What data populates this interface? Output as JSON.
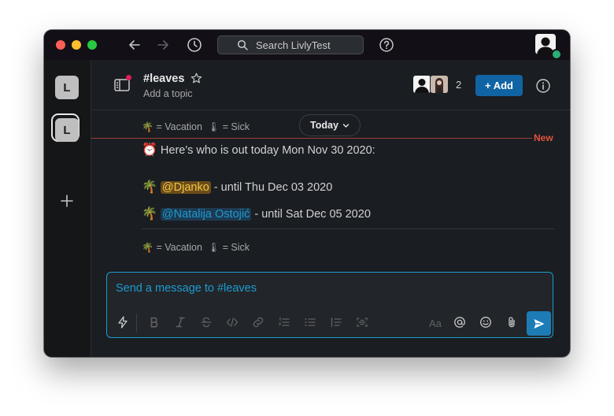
{
  "titlebar": {
    "search_placeholder": "Search LivlyTest",
    "icons": [
      "back-arrow-icon",
      "forward-arrow-icon",
      "history-clock-icon",
      "search-icon",
      "help-icon"
    ]
  },
  "workspaces": {
    "items": [
      {
        "initial": "L",
        "selected": false
      },
      {
        "initial": "L",
        "selected": true
      }
    ]
  },
  "channel": {
    "name": "#leaves",
    "topic": "Add a topic",
    "member_count": "2",
    "add_label": "+ Add"
  },
  "messages": {
    "legend_top": {
      "vacation_emoji": "🌴",
      "vacation_text": "= Vacation",
      "sick_emoji": "🌡",
      "sick_text": "= Sick"
    },
    "date_divider": "Today",
    "new_marker": "New",
    "header": {
      "emoji": "⏰",
      "text": "Here's who is out today Mon Nov 30 2020:"
    },
    "entries": [
      {
        "emoji": "🌴",
        "mention": "@Djanko",
        "text": " - until Thu Dec 03 2020"
      },
      {
        "emoji": "🌴",
        "mention": "@Natalija Ostojić",
        "text": " - until Sat Dec 05 2020"
      }
    ],
    "legend_bottom": {
      "vacation_emoji": "🌴",
      "vacation_text": "= Vacation",
      "sick_emoji": "🌡",
      "sick_text": "= Sick"
    }
  },
  "composer": {
    "placeholder": "Send a message to #leaves",
    "format_label": "Aa"
  },
  "colors": {
    "accent": "#1d9bd1",
    "add_button": "#1164a3",
    "new_marker": "#e0533f",
    "background": "#1a1d21"
  }
}
